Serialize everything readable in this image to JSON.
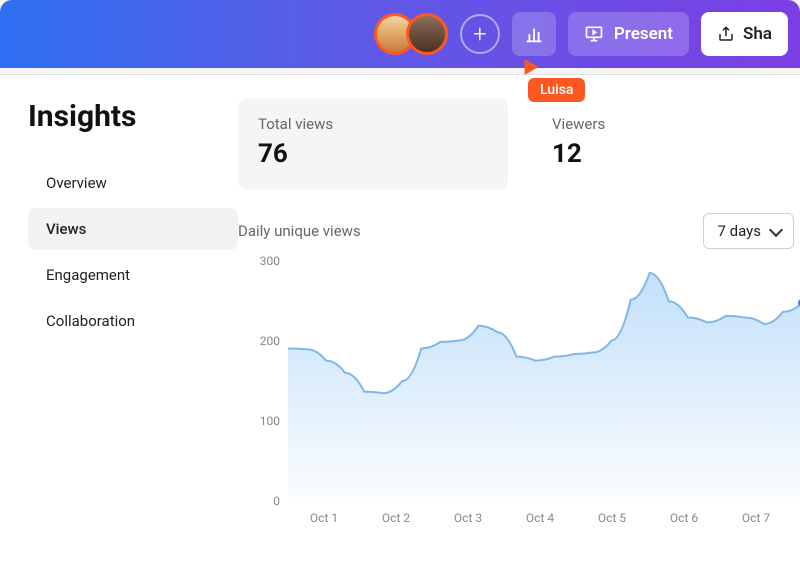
{
  "topbar": {
    "plus_label": "+",
    "present_label": "Present",
    "share_label": "Sha",
    "cursor_user": "Luisa"
  },
  "sidebar": {
    "title": "Insights",
    "items": [
      {
        "label": "Overview",
        "active": false
      },
      {
        "label": "Views",
        "active": true
      },
      {
        "label": "Engagement",
        "active": false
      },
      {
        "label": "Collaboration",
        "active": false
      }
    ]
  },
  "stats": {
    "total_views": {
      "label": "Total views",
      "value": "76"
    },
    "viewers": {
      "label": "Viewers",
      "value": "12"
    }
  },
  "chart": {
    "title": "Daily unique views",
    "range_selected": "7 days"
  },
  "chart_data": {
    "type": "line",
    "title": "Daily unique views",
    "xlabel": "",
    "ylabel": "",
    "ylim": [
      0,
      300
    ],
    "y_ticks": [
      0,
      100,
      200,
      300
    ],
    "categories": [
      "Oct 1",
      "Oct 2",
      "Oct 3",
      "Oct 4",
      "Oct 5",
      "Oct 6",
      "Oct 7"
    ],
    "series": [
      {
        "name": "Daily unique views",
        "values": [
          190,
          189,
          175,
          160,
          137,
          135,
          150,
          190,
          198,
          200,
          218,
          210,
          180,
          175,
          180,
          183,
          185,
          200,
          250,
          283,
          248,
          228,
          222,
          230,
          228,
          220,
          235,
          246
        ]
      }
    ]
  }
}
